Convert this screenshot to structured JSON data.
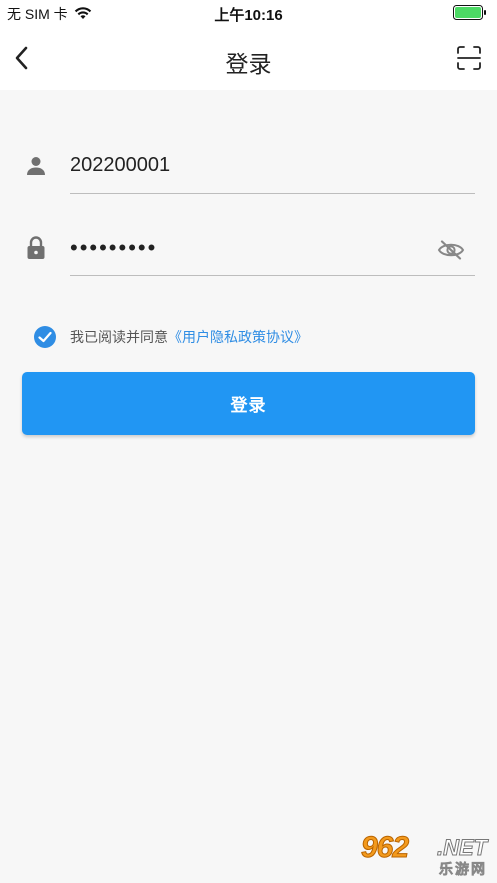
{
  "status_bar": {
    "carrier": "无 SIM 卡",
    "time": "上午10:16",
    "wifi_icon": "wifi-icon",
    "battery_icon": "battery-icon",
    "battery_color": "#4cd964"
  },
  "nav": {
    "title": "登录",
    "back_icon": "chevron-left-icon",
    "scan_icon": "scan-icon"
  },
  "form": {
    "username_value": "202200001",
    "username_icon": "person-icon",
    "password_value": "•••••••••",
    "password_icon": "lock-icon",
    "toggle_visibility_icon": "eye-off-icon"
  },
  "agreement": {
    "checked": true,
    "text": "我已阅读并同意",
    "link": "《用户隐私政策协议》"
  },
  "login_button": {
    "label": "登录"
  },
  "watermark": {
    "number": "962",
    "suffix": ".NET",
    "subtitle": "乐游网"
  },
  "colors": {
    "primary": "#2196f3",
    "link": "#2f8de4",
    "background": "#f7f7f7"
  }
}
